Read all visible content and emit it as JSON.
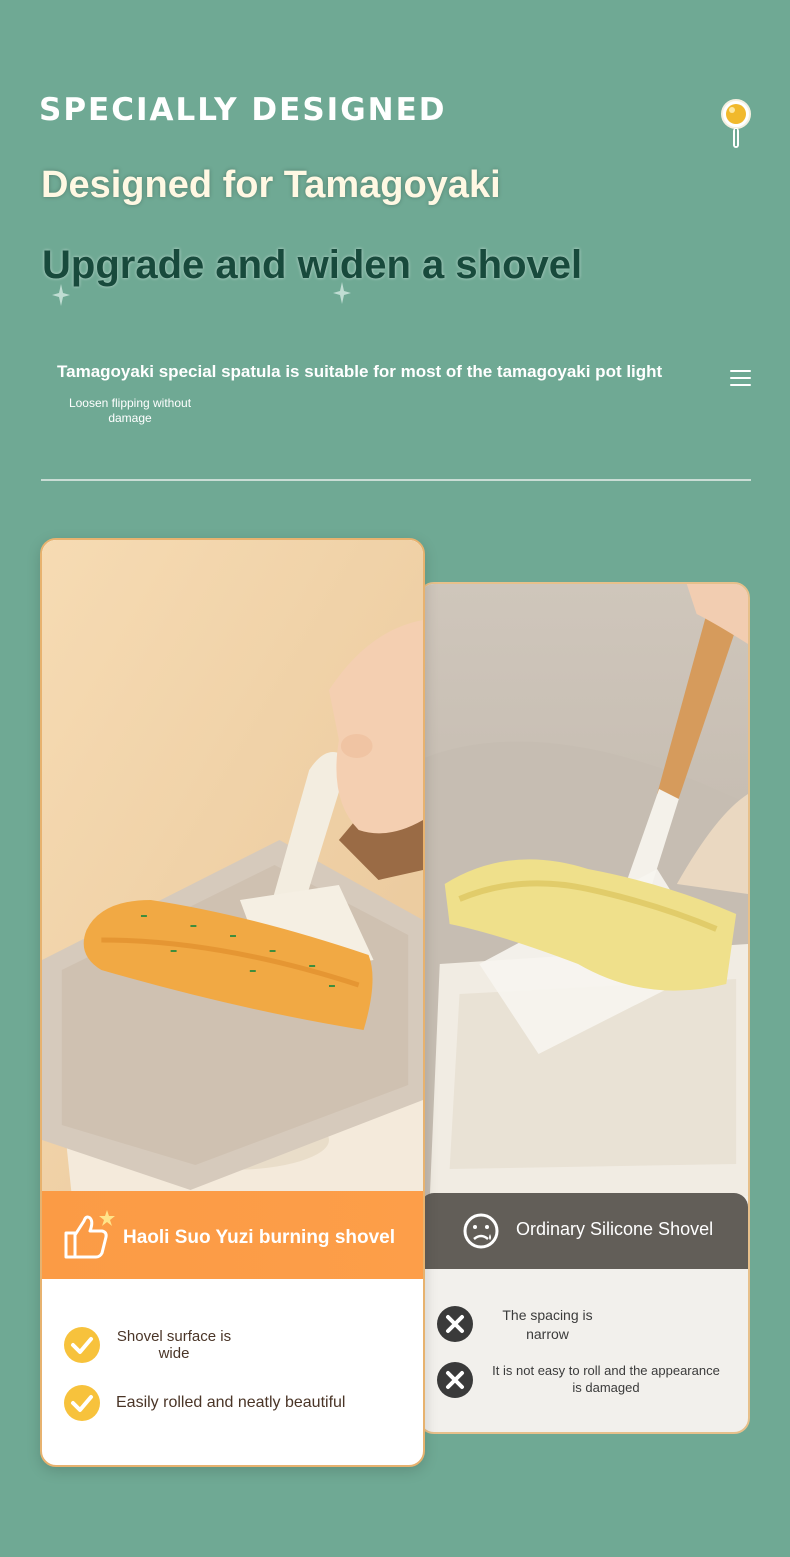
{
  "header": {
    "eyebrow": "SPECIALLY DESIGNED",
    "headline": "Designed for Tamagoyaki",
    "subhead": "Upgrade and widen a shovel",
    "description": "Tamagoyaki special spatula is suitable for most of the tamagoyaki pot light",
    "note": "Loosen flipping without damage"
  },
  "compare": {
    "left": {
      "title": "Haoli Suo Yuzi burning shovel",
      "features": [
        "Shovel surface is wide",
        "Easily rolled and neatly beautiful"
      ]
    },
    "right": {
      "title": "Ordinary Silicone Shovel",
      "drawbacks": [
        "The spacing is narrow",
        "It is not easy to roll and the appearance is damaged"
      ]
    }
  },
  "colors": {
    "background": "#6fa994",
    "accent_orange": "#fb9b45",
    "check_yellow": "#f7c23c",
    "dark_band": "#625e58",
    "subhead_green": "#184a3c"
  },
  "icons": [
    "map-pin-icon",
    "menu-icon",
    "thumbs-up-icon",
    "star-icon",
    "sad-face-icon",
    "check-icon",
    "x-icon",
    "sparkle-icon"
  ]
}
